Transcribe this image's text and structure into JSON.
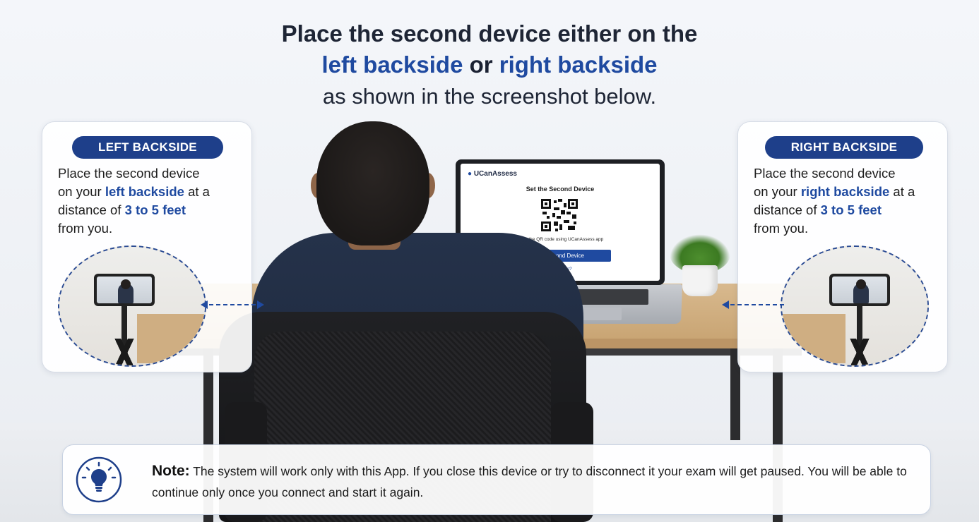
{
  "title": {
    "line1": "Place the second device either on the",
    "line2_left": "left backside",
    "line2_mid": " or ",
    "line2_right": "right backside",
    "line3": "as shown in the screenshot below."
  },
  "left_card": {
    "pill": "LEFT BACKSIDE",
    "t1": "Place the second device",
    "t2a": "on your ",
    "t2b": "left backside",
    "t2c": " at a",
    "t3a": "distance of ",
    "t3b": "3 to 5 feet",
    "t4": "from you."
  },
  "right_card": {
    "pill": "RIGHT BACKSIDE",
    "t1": "Place the second device",
    "t2a": "on your ",
    "t2b": "right backside",
    "t2c": " at a",
    "t3a": "distance of ",
    "t3b": "3 to 5 feet",
    "t4": "from you."
  },
  "laptop_app": {
    "logo": "UCanAssess",
    "heading": "Set the Second Device",
    "scan_text": "Scan the QR code using UCanAssess app",
    "button": "Set Second Device",
    "help": "Need help?"
  },
  "note": {
    "label": "Note:",
    "text": " The system will work only with this App. If you close this device or try to disconnect it your exam will get paused. You will be able to continue only once you connect and start it again."
  },
  "colors": {
    "accent_blue": "#1f4aa0",
    "pill_blue": "#1e3f8a",
    "title_dark": "#1e2535"
  },
  "icons": {
    "note_icon": "lightbulb-icon",
    "qr": "qr-code-icon"
  }
}
